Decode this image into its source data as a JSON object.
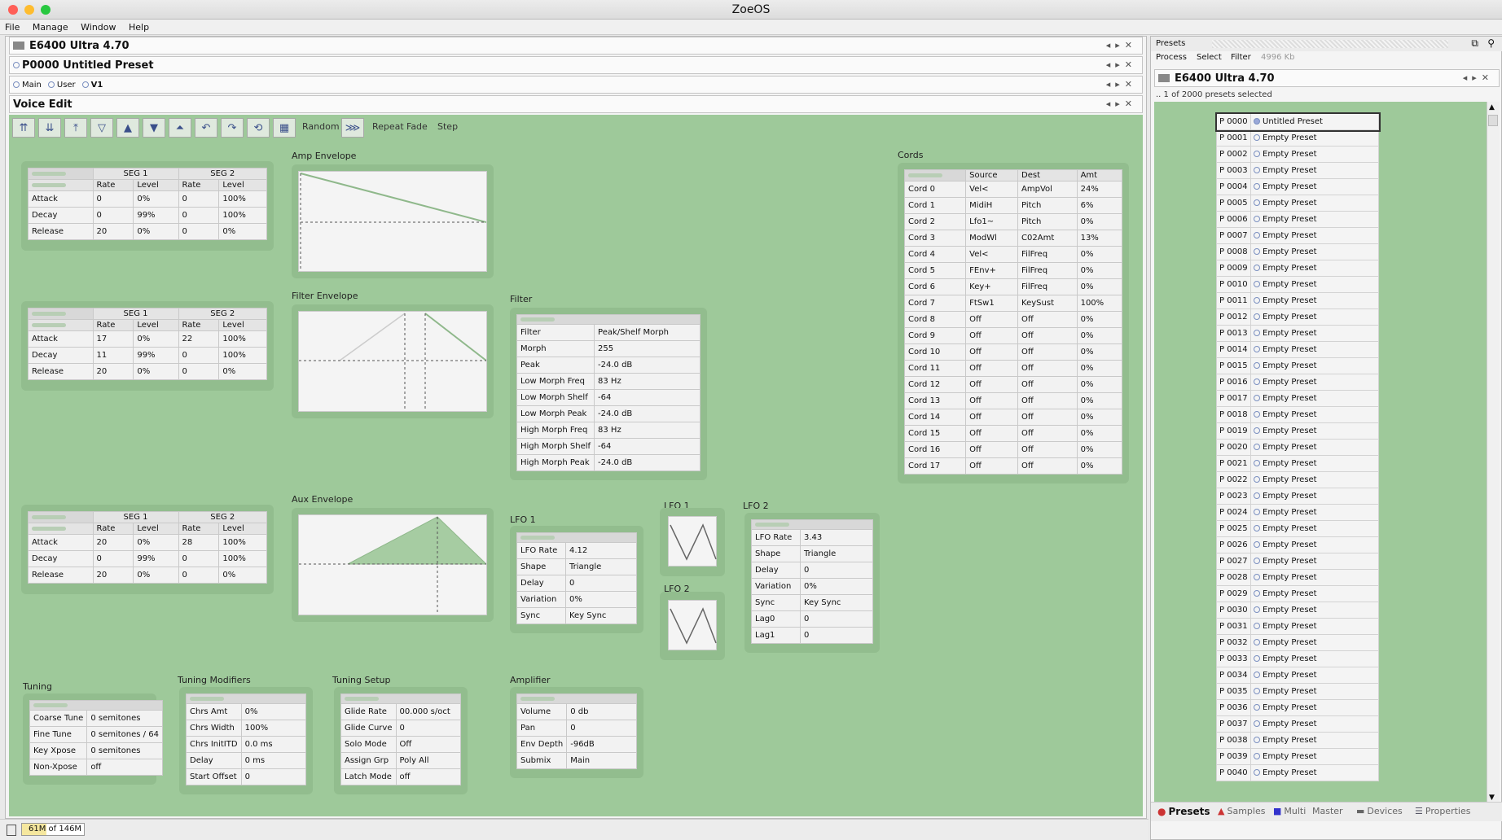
{
  "window": {
    "title": "ZoeOS"
  },
  "menu": [
    "File",
    "Manage",
    "Window",
    "Help"
  ],
  "left_headers": {
    "device": "E6400 Ultra 4.70",
    "preset": "P0000 Untitled Preset",
    "voice_edit": "Voice Edit"
  },
  "voice_tabs": [
    "Main",
    "User",
    "V1"
  ],
  "toolbar": {
    "random": "Random",
    "repeat": "Repeat",
    "fade": "Fade",
    "step": "Step"
  },
  "env_headers": {
    "seg1": "SEG 1",
    "seg2": "SEG 2",
    "rate": "Rate",
    "level": "Level"
  },
  "amp_env": {
    "title": "Amp Envelope",
    "chart_title": "Amp Envelope",
    "rows": [
      [
        "Attack",
        "0",
        "0%",
        "0",
        "100%"
      ],
      [
        "Decay",
        "0",
        "99%",
        "0",
        "100%"
      ],
      [
        "Release",
        "20",
        "0%",
        "0",
        "0%"
      ]
    ]
  },
  "filter_env": {
    "title": "Filter Envelope",
    "chart_title": "Filter Envelope",
    "rows": [
      [
        "Attack",
        "17",
        "0%",
        "22",
        "100%"
      ],
      [
        "Decay",
        "11",
        "99%",
        "0",
        "100%"
      ],
      [
        "Release",
        "20",
        "0%",
        "0",
        "0%"
      ]
    ]
  },
  "aux_env": {
    "title": "Aux Envelope",
    "chart_title": "Aux Envelope",
    "rows": [
      [
        "Attack",
        "20",
        "0%",
        "28",
        "100%"
      ],
      [
        "Decay",
        "0",
        "99%",
        "0",
        "100%"
      ],
      [
        "Release",
        "20",
        "0%",
        "0",
        "0%"
      ]
    ]
  },
  "filter": {
    "title": "Filter",
    "rows": [
      [
        "Filter",
        "Peak/Shelf Morph"
      ],
      [
        "Morph",
        "255"
      ],
      [
        "Peak",
        "-24.0 dB"
      ],
      [
        "Low Morph Freq",
        "83 Hz"
      ],
      [
        "Low Morph Shelf",
        "-64"
      ],
      [
        "Low Morph Peak",
        "-24.0 dB"
      ],
      [
        "High Morph Freq",
        "83 Hz"
      ],
      [
        "High Morph Shelf",
        "-64"
      ],
      [
        "High Morph Peak",
        "-24.0 dB"
      ]
    ]
  },
  "cords": {
    "title": "Cords",
    "headers": [
      "Source",
      "Dest",
      "Amt"
    ],
    "rows": [
      [
        "Cord 0",
        "Vel<",
        "AmpVol",
        "24%"
      ],
      [
        "Cord 1",
        "MidiH",
        "Pitch",
        "6%"
      ],
      [
        "Cord 2",
        "Lfo1~",
        "Pitch",
        "0%"
      ],
      [
        "Cord 3",
        "ModWl",
        "C02Amt",
        "13%"
      ],
      [
        "Cord 4",
        "Vel<",
        "FilFreq",
        "0%"
      ],
      [
        "Cord 5",
        "FEnv+",
        "FilFreq",
        "0%"
      ],
      [
        "Cord 6",
        "Key+",
        "FilFreq",
        "0%"
      ],
      [
        "Cord 7",
        "FtSw1",
        "KeySust",
        "100%"
      ],
      [
        "Cord 8",
        "Off",
        "Off",
        "0%"
      ],
      [
        "Cord 9",
        "Off",
        "Off",
        "0%"
      ],
      [
        "Cord 10",
        "Off",
        "Off",
        "0%"
      ],
      [
        "Cord 11",
        "Off",
        "Off",
        "0%"
      ],
      [
        "Cord 12",
        "Off",
        "Off",
        "0%"
      ],
      [
        "Cord 13",
        "Off",
        "Off",
        "0%"
      ],
      [
        "Cord 14",
        "Off",
        "Off",
        "0%"
      ],
      [
        "Cord 15",
        "Off",
        "Off",
        "0%"
      ],
      [
        "Cord 16",
        "Off",
        "Off",
        "0%"
      ],
      [
        "Cord 17",
        "Off",
        "Off",
        "0%"
      ]
    ]
  },
  "lfo1": {
    "title": "LFO 1",
    "rows": [
      [
        "LFO Rate",
        "4.12"
      ],
      [
        "Shape",
        "Triangle"
      ],
      [
        "Delay",
        "0"
      ],
      [
        "Variation",
        "0%"
      ],
      [
        "Sync",
        "Key Sync"
      ]
    ]
  },
  "lfo_icons": {
    "lfo1": "LFO 1",
    "lfo2": "LFO 2"
  },
  "lfo2": {
    "title": "LFO 2",
    "rows": [
      [
        "LFO Rate",
        "3.43"
      ],
      [
        "Shape",
        "Triangle"
      ],
      [
        "Delay",
        "0"
      ],
      [
        "Variation",
        "0%"
      ],
      [
        "Sync",
        "Key Sync"
      ],
      [
        "Lag0",
        "0"
      ],
      [
        "Lag1",
        "0"
      ]
    ]
  },
  "tuning": {
    "title": "Tuning",
    "rows": [
      [
        "Coarse Tune",
        "0 semitones"
      ],
      [
        "Fine Tune",
        "0 semitones / 64"
      ],
      [
        "Key Xpose",
        "0 semitones"
      ],
      [
        "Non-Xpose",
        "off"
      ]
    ]
  },
  "tuning_mod": {
    "title": "Tuning Modifiers",
    "rows": [
      [
        "Chrs Amt",
        "0%"
      ],
      [
        "Chrs Width",
        "100%"
      ],
      [
        "Chrs InitITD",
        "0.0 ms"
      ],
      [
        "Delay",
        "0 ms"
      ],
      [
        "Start Offset",
        "0"
      ]
    ]
  },
  "tuning_setup": {
    "title": "Tuning Setup",
    "rows": [
      [
        "Glide Rate",
        "00.000 s/oct"
      ],
      [
        "Glide Curve",
        "0"
      ],
      [
        "Solo Mode",
        "Off"
      ],
      [
        "Assign Grp",
        "Poly All"
      ],
      [
        "Latch Mode",
        "off"
      ]
    ]
  },
  "amplifier": {
    "title": "Amplifier",
    "rows": [
      [
        "Volume",
        "0 db"
      ],
      [
        "Pan",
        "0"
      ],
      [
        "Env Depth",
        "-96dB"
      ],
      [
        "Submix",
        "Main"
      ]
    ]
  },
  "status": {
    "memory": "61M of 146M"
  },
  "right": {
    "title": "Presets",
    "menu": [
      "Process",
      "Select",
      "Filter"
    ],
    "mem": "4996 Kb",
    "device": "E6400 Ultra 4.70",
    "selected": ".. 1 of 2000 presets selected",
    "presets": [
      [
        "P 0000",
        "Untitled Preset"
      ],
      [
        "P 0001",
        "Empty Preset"
      ],
      [
        "P 0002",
        "Empty Preset"
      ],
      [
        "P 0003",
        "Empty Preset"
      ],
      [
        "P 0004",
        "Empty Preset"
      ],
      [
        "P 0005",
        "Empty Preset"
      ],
      [
        "P 0006",
        "Empty Preset"
      ],
      [
        "P 0007",
        "Empty Preset"
      ],
      [
        "P 0008",
        "Empty Preset"
      ],
      [
        "P 0009",
        "Empty Preset"
      ],
      [
        "P 0010",
        "Empty Preset"
      ],
      [
        "P 0011",
        "Empty Preset"
      ],
      [
        "P 0012",
        "Empty Preset"
      ],
      [
        "P 0013",
        "Empty Preset"
      ],
      [
        "P 0014",
        "Empty Preset"
      ],
      [
        "P 0015",
        "Empty Preset"
      ],
      [
        "P 0016",
        "Empty Preset"
      ],
      [
        "P 0017",
        "Empty Preset"
      ],
      [
        "P 0018",
        "Empty Preset"
      ],
      [
        "P 0019",
        "Empty Preset"
      ],
      [
        "P 0020",
        "Empty Preset"
      ],
      [
        "P 0021",
        "Empty Preset"
      ],
      [
        "P 0022",
        "Empty Preset"
      ],
      [
        "P 0023",
        "Empty Preset"
      ],
      [
        "P 0024",
        "Empty Preset"
      ],
      [
        "P 0025",
        "Empty Preset"
      ],
      [
        "P 0026",
        "Empty Preset"
      ],
      [
        "P 0027",
        "Empty Preset"
      ],
      [
        "P 0028",
        "Empty Preset"
      ],
      [
        "P 0029",
        "Empty Preset"
      ],
      [
        "P 0030",
        "Empty Preset"
      ],
      [
        "P 0031",
        "Empty Preset"
      ],
      [
        "P 0032",
        "Empty Preset"
      ],
      [
        "P 0033",
        "Empty Preset"
      ],
      [
        "P 0034",
        "Empty Preset"
      ],
      [
        "P 0035",
        "Empty Preset"
      ],
      [
        "P 0036",
        "Empty Preset"
      ],
      [
        "P 0037",
        "Empty Preset"
      ],
      [
        "P 0038",
        "Empty Preset"
      ],
      [
        "P 0039",
        "Empty Preset"
      ],
      [
        "P 0040",
        "Empty Preset"
      ]
    ],
    "tabs": [
      "Presets",
      "Samples",
      "Multi",
      "Master",
      "Devices",
      "Properties"
    ]
  }
}
